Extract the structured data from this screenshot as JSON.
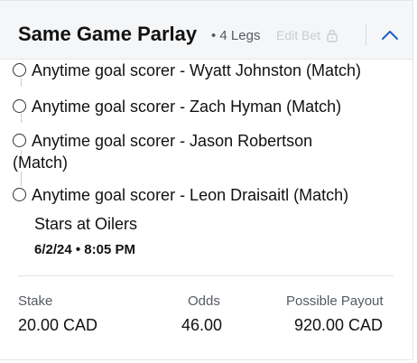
{
  "header": {
    "title": "Same Game Parlay",
    "legs_count": "• 4 Legs",
    "edit_bet_label": "Edit Bet",
    "lock_icon": "lock-icon",
    "collapse_icon": "chevron-up-icon",
    "accent_color": "#1f5fbf"
  },
  "legs": [
    {
      "text": "Anytime goal scorer - Wyatt Johnston (Match)"
    },
    {
      "text": "Anytime goal scorer - Zach Hyman (Match)"
    },
    {
      "text": "Anytime goal scorer - Jason Robertson",
      "text_line2": "(Match)"
    },
    {
      "text": "Anytime goal scorer - Leon Draisaitl (Match)"
    }
  ],
  "game": {
    "matchup": "Stars at Oilers",
    "datetime": "6/2/24 • 8:05 PM"
  },
  "summary": {
    "stake_label": "Stake",
    "stake_value": "20.00 CAD",
    "odds_label": "Odds",
    "odds_value": "46.00",
    "payout_label": "Possible Payout",
    "payout_value": "920.00 CAD"
  }
}
